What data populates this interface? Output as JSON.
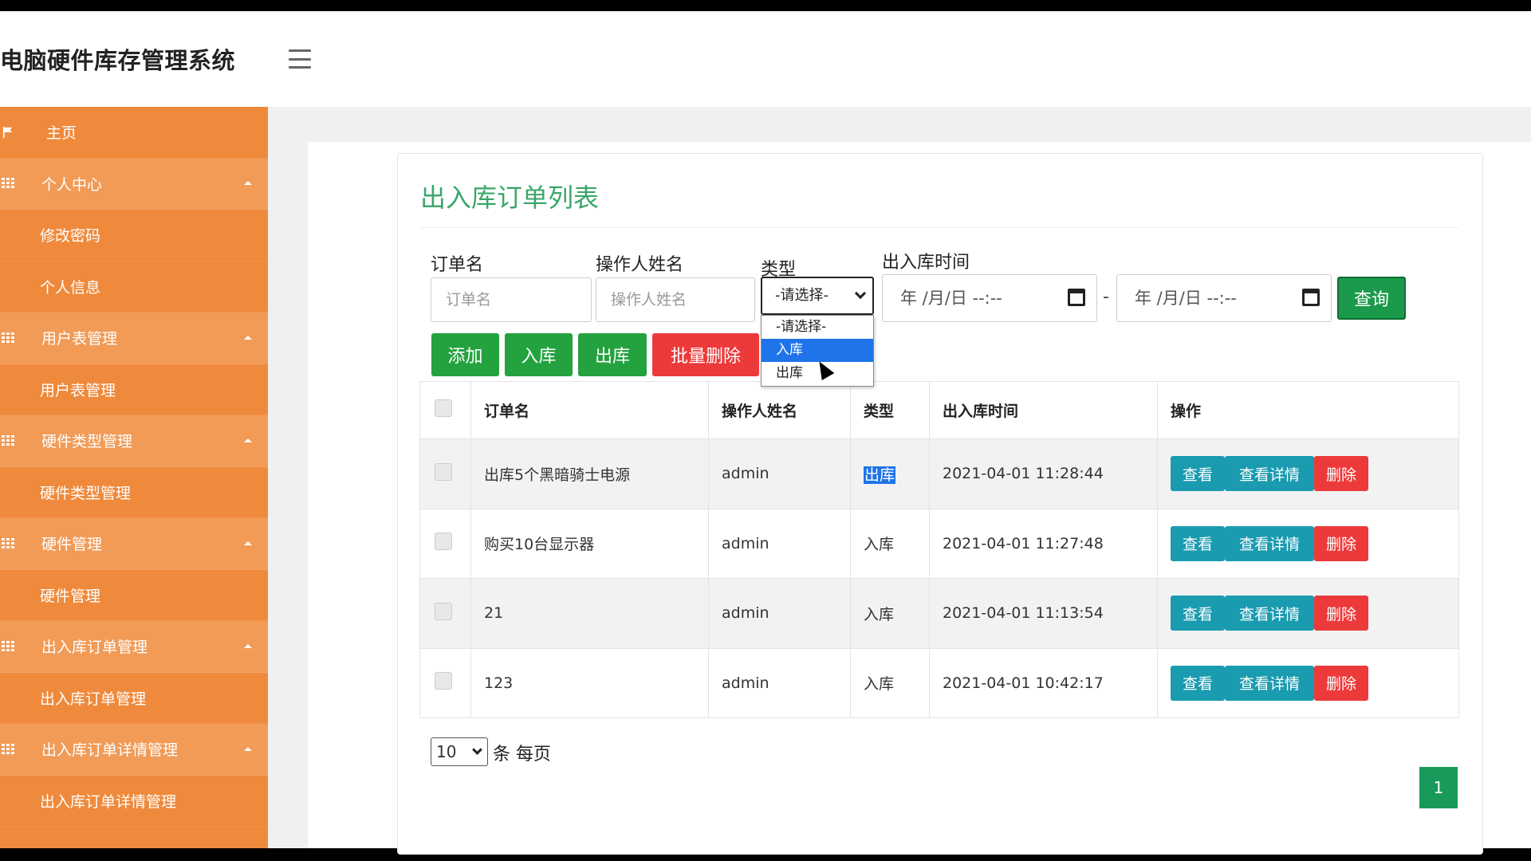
{
  "header": {
    "title": "电脑硬件库存管理系统"
  },
  "sidebar": {
    "items": [
      {
        "label": "主页",
        "kind": "home"
      },
      {
        "label": "个人中心",
        "kind": "group"
      },
      {
        "label": "修改密码",
        "kind": "sub"
      },
      {
        "label": "个人信息",
        "kind": "sub"
      },
      {
        "label": "用户表管理",
        "kind": "group"
      },
      {
        "label": "用户表管理",
        "kind": "sub"
      },
      {
        "label": "硬件类型管理",
        "kind": "group"
      },
      {
        "label": "硬件类型管理",
        "kind": "sub"
      },
      {
        "label": "硬件管理",
        "kind": "group"
      },
      {
        "label": "硬件管理",
        "kind": "sub"
      },
      {
        "label": "出入库订单管理",
        "kind": "group"
      },
      {
        "label": "出入库订单管理",
        "kind": "sub"
      },
      {
        "label": "出入库订单详情管理",
        "kind": "group"
      },
      {
        "label": "出入库订单详情管理",
        "kind": "sub"
      }
    ]
  },
  "panel": {
    "title": "出入库订单列表"
  },
  "filters": {
    "order_name_label": "订单名",
    "order_name_placeholder": "订单名",
    "operator_label": "操作人姓名",
    "operator_placeholder": "操作人姓名",
    "type_label": "类型",
    "type_selected": "-请选择-",
    "type_options": [
      "-请选择-",
      "入库",
      "出库"
    ],
    "type_highlighted": "入库",
    "time_label": "出入库时间",
    "date_start_placeholder": "年 /月/日 --:--",
    "date_end_placeholder": "年 /月/日 --:--",
    "date_separator": "-",
    "query_label": "查询"
  },
  "toolbar": {
    "add_label": "添加",
    "in_label": "入库",
    "out_label": "出库",
    "batch_delete_label": "批量删除"
  },
  "table": {
    "headers": [
      "订单名",
      "操作人姓名",
      "类型",
      "出入库时间",
      "操作"
    ],
    "rows": [
      {
        "name": "出库5个黑暗骑士电源",
        "operator": "admin",
        "type": "出库",
        "time": "2021-04-01 11:28:44"
      },
      {
        "name": "购买10台显示器",
        "operator": "admin",
        "type": "入库",
        "time": "2021-04-01 11:27:48"
      },
      {
        "name": "21",
        "operator": "admin",
        "type": "入库",
        "time": "2021-04-01 11:13:54"
      },
      {
        "name": "123",
        "operator": "admin",
        "type": "入库",
        "time": "2021-04-01 10:42:17"
      }
    ],
    "actions": {
      "view": "查看",
      "view_detail": "查看详情",
      "delete": "删除"
    }
  },
  "pagination": {
    "page_size": "10",
    "per_page_text": "条 每页",
    "current_page": "1"
  },
  "colors": {
    "sidebar": "#ef8a3c",
    "sidebar_group": "#f19b57",
    "title_green": "#3aa66a",
    "button_green": "#24a23f",
    "button_red": "#ec3a3a",
    "action_teal": "#1a9bb0",
    "select_highlight": "#1e74e8"
  }
}
